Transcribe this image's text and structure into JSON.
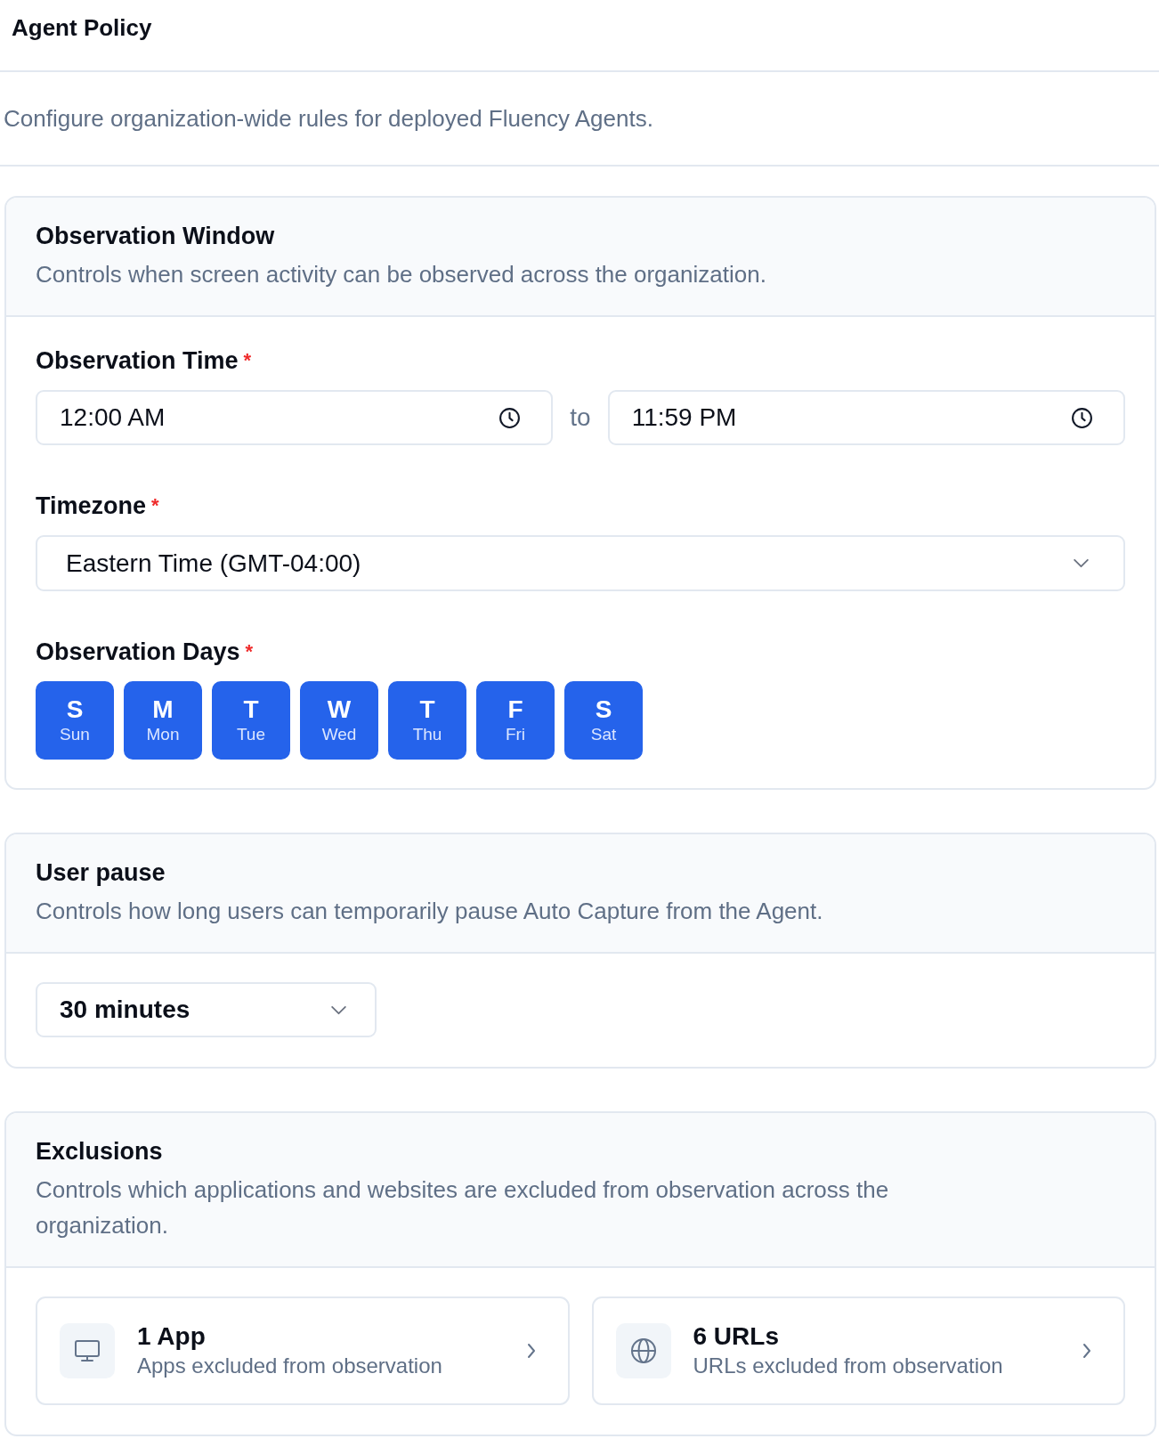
{
  "page": {
    "title": "Agent Policy",
    "description": "Configure organization-wide rules for deployed Fluency Agents."
  },
  "observation_window": {
    "title": "Observation Window",
    "description": "Controls when screen activity can be observed across the organization.",
    "observation_time": {
      "label": "Observation Time",
      "required_mark": "*",
      "start": "12:00 AM",
      "separator": "to",
      "end": "11:59 PM"
    },
    "timezone": {
      "label": "Timezone",
      "required_mark": "*",
      "value": "Eastern Time (GMT-04:00)"
    },
    "observation_days": {
      "label": "Observation Days",
      "required_mark": "*",
      "days": [
        {
          "letter": "S",
          "name": "Sun",
          "selected": true
        },
        {
          "letter": "M",
          "name": "Mon",
          "selected": true
        },
        {
          "letter": "T",
          "name": "Tue",
          "selected": true
        },
        {
          "letter": "W",
          "name": "Wed",
          "selected": true
        },
        {
          "letter": "T",
          "name": "Thu",
          "selected": true
        },
        {
          "letter": "F",
          "name": "Fri",
          "selected": true
        },
        {
          "letter": "S",
          "name": "Sat",
          "selected": true
        }
      ]
    }
  },
  "user_pause": {
    "title": "User pause",
    "description": "Controls how long users can temporarily pause Auto Capture from the Agent.",
    "duration": {
      "value": "30 minutes"
    }
  },
  "exclusions": {
    "title": "Exclusions",
    "description": "Controls which applications and websites are excluded from observation across the organization.",
    "items": [
      {
        "kind": "apps",
        "count": "1 App",
        "caption": "Apps excluded from observation"
      },
      {
        "kind": "urls",
        "count": "6 URLs",
        "caption": "URLs excluded from observation"
      }
    ]
  }
}
